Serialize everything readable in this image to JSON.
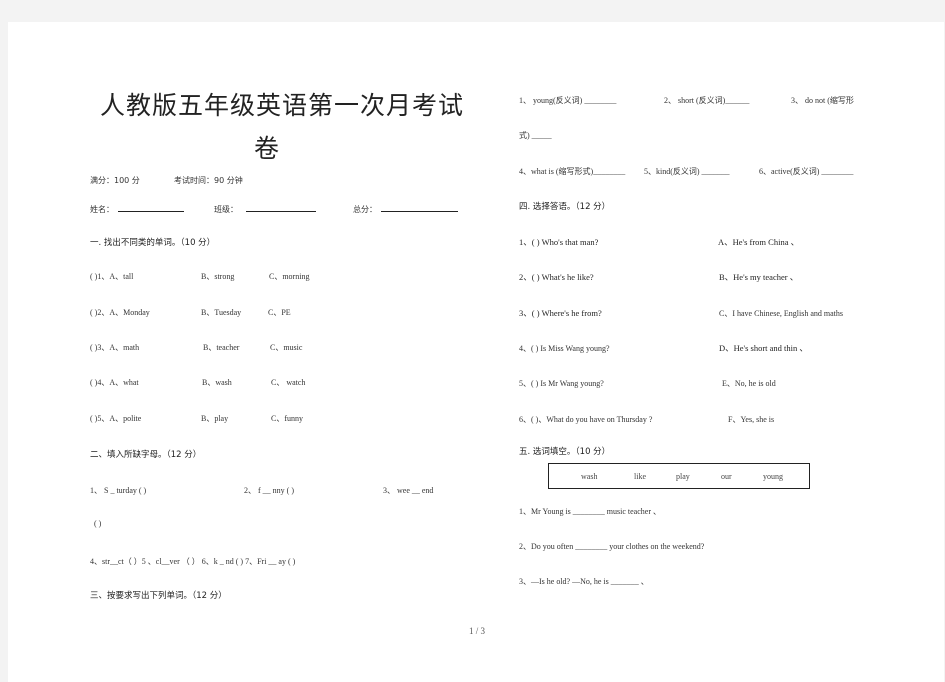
{
  "title_line1": "人教版五年级英语第一次月考试",
  "title_line2": "卷",
  "meta": {
    "full_score": "满分：100 分",
    "exam_time": "考试时间：90 分钟",
    "name_label": "姓名：",
    "class_label": "班级：",
    "total_label": "总分："
  },
  "section1": {
    "heading": "一. 找出不同类的单词。（10 分）",
    "items": [
      {
        "num": "(        )1、A、tall",
        "b": "B、strong",
        "c": "C、morning"
      },
      {
        "num": "(        )2、A、Monday",
        "b": "B、Tuesday",
        "c": "C、PE"
      },
      {
        "num": "(        )3、A、math",
        "b": "B、teacher",
        "c": "C、music"
      },
      {
        "num": "(        )4、A、what",
        "b": "B、wash",
        "c": "C、  watch"
      },
      {
        "num": "(        )5、A、polite",
        "b": "B、play",
        "c": "C、funny"
      }
    ]
  },
  "section2": {
    "heading": "二、填入所缺字母。（12 分）",
    "row1": [
      "1、 S _ turday (                )",
      "2、 f __ nny (              )",
      "3、 wee __ end"
    ],
    "row1_cont": "(            )",
    "row2": "4、str__ct（       ）5 、cl__ver （       ） 6、k _ nd  (            )   7、Fri __ ay (            )"
  },
  "section3": {
    "heading": "三、按要求写出下列单词。（12 分）",
    "row1": [
      "1、 young(反义词) ________",
      "2、 short (反义词)______",
      "3、 do not (缩写形"
    ],
    "row1_cont": "式) _____",
    "row2": [
      "4、what is (缩写形式)________",
      "5、kind(反义词) _______",
      "6、active(反义词) ________"
    ]
  },
  "section4": {
    "heading": "四. 选择答语。（12 分）",
    "questions": [
      "1、(    ) Who's that man?",
      "2、(    ) What's he like?",
      "3、(    ) Where's he from?",
      "4、(    ) Is Miss Wang young?",
      "5、(    ) Is Mr Wang young?",
      "6、(    )、What do you have on Thursday ?"
    ],
    "answers": [
      "A、He's from China 、",
      "B、He's my teacher 、",
      "C、I have Chinese, English and maths",
      "D、He's short and thin 、",
      "E、No, he is old",
      "F、Yes, she is"
    ]
  },
  "section5": {
    "heading": "五. 选词填空。（10 分）",
    "words": [
      "wash",
      "like",
      "play",
      "our",
      "young"
    ],
    "items": [
      "1、Mr Young is ________ music teacher 、",
      "2、Do you often ________ your clothes on the weekend?",
      "3、—Is he old?          —No, he is _______  、"
    ]
  },
  "footer": {
    "page_number": "1  /  3"
  }
}
